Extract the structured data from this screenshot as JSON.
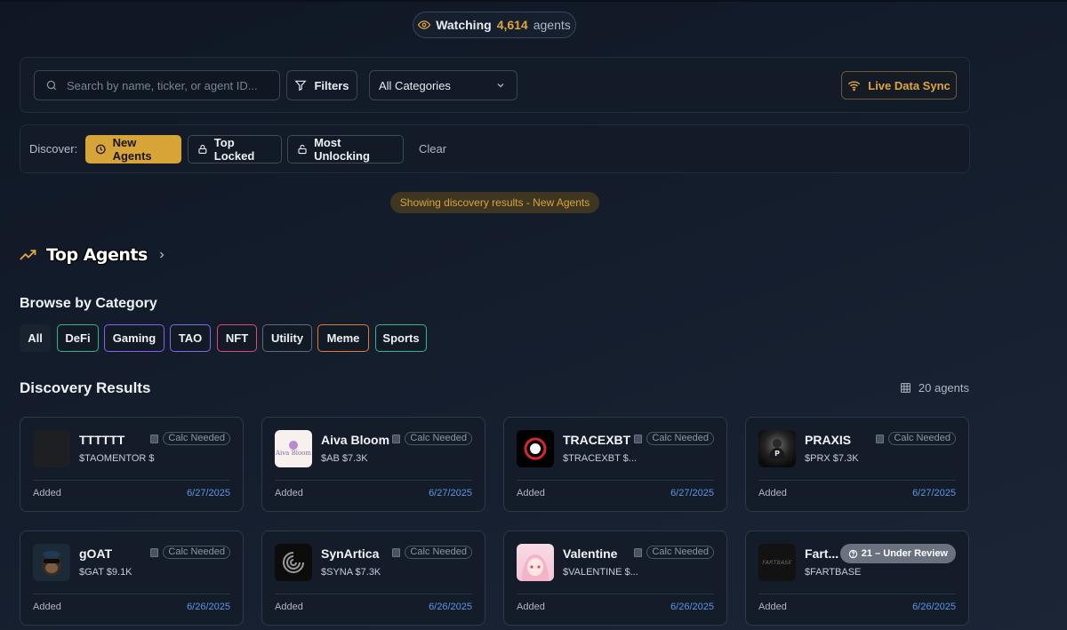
{
  "watching": {
    "prefix": "Watching",
    "count": "4,614",
    "suffix": "agents"
  },
  "search": {
    "placeholder": "Search by name, ticker, or agent ID..."
  },
  "filters_label": "Filters",
  "category_select": {
    "value": "All Categories"
  },
  "live_sync_label": "Live Data Sync",
  "discover": {
    "label": "Discover:",
    "buttons": [
      "New Agents",
      "Top Locked",
      "Most Unlocking"
    ],
    "clear": "Clear"
  },
  "showing_text": "Showing discovery results - New Agents",
  "top_agents_title": "Top Agents",
  "browse_title": "Browse by Category",
  "categories": [
    {
      "label": "All",
      "color": "#1a2230"
    },
    {
      "label": "DeFi",
      "color": "#2fb58a"
    },
    {
      "label": "Gaming",
      "color": "#8b5cf6"
    },
    {
      "label": "TAO",
      "color": "#7c6cf0"
    },
    {
      "label": "NFT",
      "color": "#e0477f"
    },
    {
      "label": "Utility",
      "color": "#5f6a7a"
    },
    {
      "label": "Meme",
      "color": "#e07b34"
    },
    {
      "label": "Sports",
      "color": "#2fb58a"
    }
  ],
  "discovery_title": "Discovery Results",
  "agent_count": "20 agents",
  "cards": [
    {
      "name": "TTTTTT",
      "ticker": "$TAOMENTOR  $",
      "badge": "Calc Needed",
      "added": "Added",
      "date": "6/27/2025"
    },
    {
      "name": "Aiva Bloom",
      "ticker": "$AB  $7.3K",
      "badge": "Calc Needed",
      "added": "Added",
      "date": "6/27/2025"
    },
    {
      "name": "TRACEXBT",
      "ticker": "$TRACEXBT  $...",
      "badge": "Calc Needed",
      "added": "Added",
      "date": "6/27/2025"
    },
    {
      "name": "PRAXIS",
      "ticker": "$PRX  $7.3K",
      "badge": "Calc Needed",
      "added": "Added",
      "date": "6/27/2025"
    },
    {
      "name": "gOAT",
      "ticker": "$GAT  $9.1K",
      "badge": "Calc Needed",
      "added": "Added",
      "date": "6/26/2025"
    },
    {
      "name": "SynArtica",
      "ticker": "$SYNA  $7.3K",
      "badge": "Calc Needed",
      "added": "Added",
      "date": "6/26/2025"
    },
    {
      "name": "Valentine",
      "ticker": "$VALENTINE  $...",
      "badge": "Calc Needed",
      "added": "Added",
      "date": "6/26/2025"
    },
    {
      "name": "Fart...",
      "ticker": "$FARTBASE",
      "badge": "21 – Under Review",
      "added": "Added",
      "date": "6/26/2025"
    }
  ],
  "thumb_text": {
    "aiva": "Aiva Bloom",
    "fart": "FARTBASE"
  }
}
